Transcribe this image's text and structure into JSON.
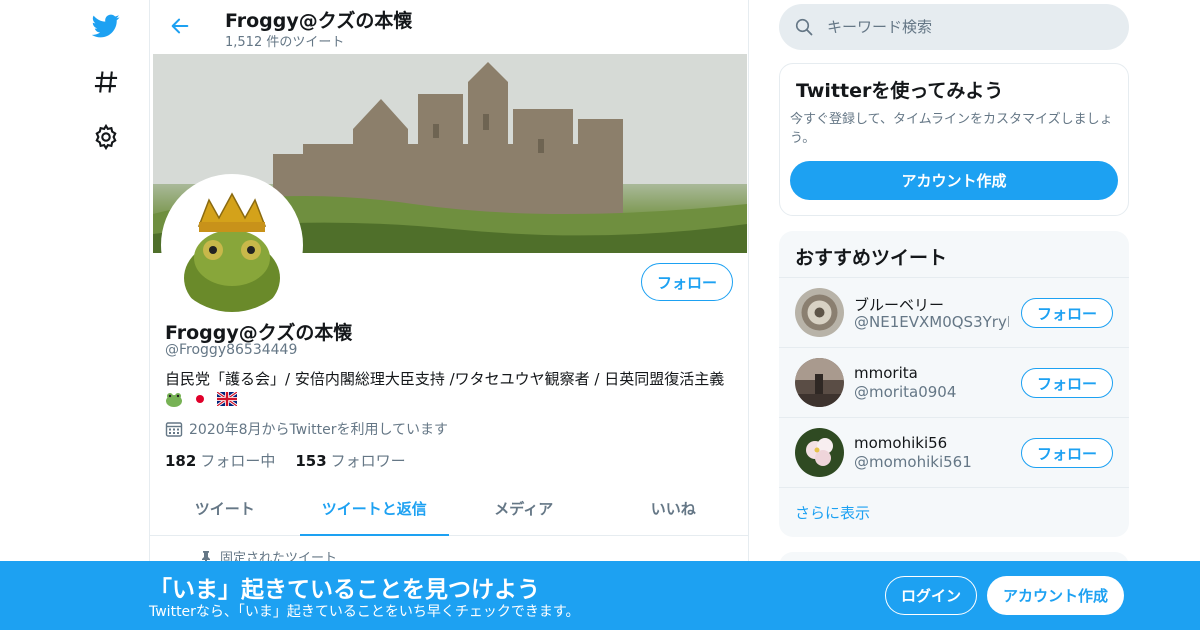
{
  "colors": {
    "accent": "#1da1f2",
    "text": "#14171a",
    "secondary": "#657786",
    "border": "#e6ecf0"
  },
  "nav": {
    "icons": [
      "twitter-logo-icon",
      "hashtag-icon",
      "gear-icon"
    ]
  },
  "header": {
    "title": "Froggy@クズの本懐",
    "tweet_count": "1,512 件のツイート"
  },
  "profile": {
    "follow_label": "フォロー",
    "name": "Froggy@クズの本懐",
    "handle": "@Froggy86534449",
    "bio": "自民党「護る会」/ 安倍内閣総理大臣支持 /ワタセユウヤ観察者 / 日英同盟復活主義",
    "bio_emoji": [
      "frog-emoji",
      "japan-flag-emoji",
      "uk-flag-emoji"
    ],
    "joined": "2020年8月からTwitterを利用しています",
    "following_count": "182",
    "following_label": "フォロー中",
    "followers_count": "153",
    "followers_label": "フォロワー"
  },
  "tabs": [
    {
      "label": "ツイート",
      "active": false
    },
    {
      "label": "ツイートと返信",
      "active": true
    },
    {
      "label": "メディア",
      "active": false
    },
    {
      "label": "いいね",
      "active": false
    }
  ],
  "pinned_label": "固定されたツイート",
  "search": {
    "placeholder": "キーワード検索"
  },
  "signup_card": {
    "title": "Twitterを使ってみよう",
    "description": "今すぐ登録して、タイムラインをカスタマイズしましょう。",
    "button": "アカウント作成"
  },
  "recommended": {
    "title": "おすすめツイート",
    "follow_label": "フォロー",
    "items": [
      {
        "name": "ブルーベリー",
        "handle": "@NE1EVXM0QS3YryI"
      },
      {
        "name": "mmorita",
        "handle": "@morita0904"
      },
      {
        "name": "momohiki56",
        "handle": "@momohiki561"
      }
    ],
    "more": "さらに表示"
  },
  "bottom_bar": {
    "title": "「いま」起きていることを見つけよう",
    "subtitle": "Twitterなら、「いま」起きていることをいち早くチェックできます。",
    "login": "ログイン",
    "signup": "アカウント作成"
  }
}
